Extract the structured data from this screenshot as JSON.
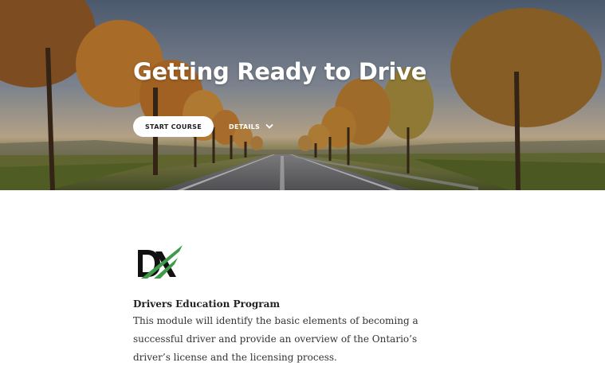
{
  "hero": {
    "title": "Getting Ready to Drive",
    "start_label": "START COURSE",
    "details_label": "DETAILS",
    "details_icon": "chevron-down-icon"
  },
  "content": {
    "logo_icon": "dx-logo",
    "program_title": "Drivers Education Program",
    "program_description": "This module will identify the basic elements of becoming a successful driver and provide an overview of the Ontario’s driver’s license and the licensing process."
  },
  "colors": {
    "logo_black": "#111111",
    "logo_green": "#3f9a4a",
    "button_bg": "#ffffff",
    "hero_text": "#ffffff"
  }
}
